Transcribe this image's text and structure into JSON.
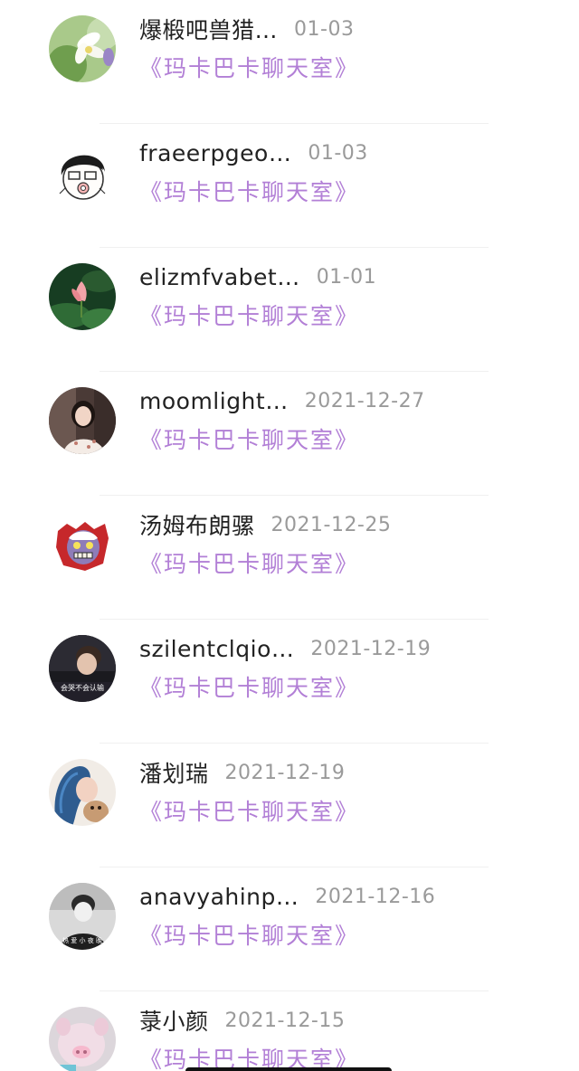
{
  "messages": [
    {
      "name": "爆椴吧兽猎…",
      "date": "01-03",
      "room": "《玛卡巴卡聊天室》",
      "avatar_icon": "flower-avatar"
    },
    {
      "name": "fraeerpgeo…",
      "date": "01-03",
      "room": "《玛卡巴卡聊天室》",
      "avatar_icon": "cartoon-face-avatar"
    },
    {
      "name": "elizmfvabet…",
      "date": "01-01",
      "room": "《玛卡巴卡聊天室》",
      "avatar_icon": "lotus-avatar"
    },
    {
      "name": "moomlight…",
      "date": "2021-12-27",
      "room": "《玛卡巴卡聊天室》",
      "avatar_icon": "girl-photo-avatar"
    },
    {
      "name": "汤姆布朗骡",
      "date": "2021-12-25",
      "room": "《玛卡巴卡聊天室》",
      "avatar_icon": "monster-cartoon-avatar"
    },
    {
      "name": "szilentclqio…",
      "date": "2021-12-19",
      "room": "《玛卡巴卡聊天室》",
      "avatar_icon": "boy-photo-avatar"
    },
    {
      "name": "潘划瑞",
      "date": "2021-12-19",
      "room": "《玛卡巴卡聊天室》",
      "avatar_icon": "blue-hair-avatar"
    },
    {
      "name": "anavyahinp…",
      "date": "2021-12-16",
      "room": "《玛卡巴卡聊天室》",
      "avatar_icon": "bw-photo-avatar"
    },
    {
      "name": "菉小颜",
      "date": "2021-12-15",
      "room": "《玛卡巴卡聊天室》",
      "avatar_icon": "pig-avatar"
    }
  ],
  "avatar_captions": {
    "boy": "会哭不会认输",
    "bw": "热 爱 小 夜 晚"
  },
  "colors": {
    "room_text": "#b27fd6",
    "name_text": "#222222",
    "date_text": "#9a9a9a"
  }
}
